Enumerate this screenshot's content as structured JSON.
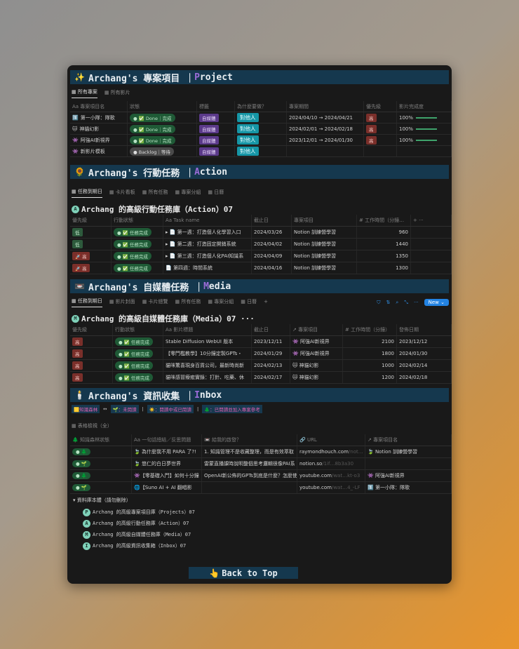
{
  "project": {
    "icon": "sparkles-icon",
    "title_pre": "Archang's 專案項目 ｜ ",
    "title_acc": "P",
    "title_post": "roject",
    "tabs": [
      "所有專案",
      "所有影片"
    ],
    "headers": [
      "Aa 專案項目名",
      "狀態",
      "標籤",
      "為什麼要做？",
      "專案期間",
      "優先級",
      "影片完成度"
    ],
    "rows": [
      {
        "icon": "1️⃣",
        "name": "第一小隊：隊歌",
        "status": "● ✅ Done｜完成",
        "tag": "自媒體",
        "why": "對他人",
        "period": "2024/04/10 → 2024/04/21",
        "priority": "高",
        "progress": "100%",
        "progress_value": 100
      },
      {
        "icon": "🐱",
        "name": "神貓幻影",
        "status": "● ✅ Done｜完成",
        "tag": "自媒體",
        "why": "對他人",
        "period": "2024/02/01 → 2024/02/18",
        "priority": "高",
        "progress": "100%",
        "progress_value": 100
      },
      {
        "icon": "👾",
        "name": "阿強AI新視界",
        "status": "● ✅ Done｜完成",
        "tag": "自媒體",
        "why": "對他人",
        "period": "2023/12/01 → 2024/01/30",
        "priority": "高",
        "progress": "100%",
        "progress_value": 100
      },
      {
        "icon": "👾",
        "name": "新影片模板",
        "status": "● Backlog｜等待",
        "tag": "自媒體",
        "why": "對他人",
        "period": "",
        "priority": "",
        "progress": "",
        "progress_value": 0
      }
    ]
  },
  "action": {
    "title_pre": "Archang's 行動任務 ｜ ",
    "title_acc": "A",
    "title_post": "ction",
    "tabs": [
      "任務到期日",
      "卡片看板",
      "所有任務",
      "專案分組",
      "日曆"
    ],
    "db_title": "Archang 的高級行動任務庫（Action）07",
    "headers": [
      "優先級",
      "行動狀態",
      "Aa Task name",
      "截止日",
      "專案項目",
      "# 工作時間（分鐘…",
      "+ ···"
    ],
    "rows": [
      {
        "priority": "低",
        "status": "● ✅ 任務完成",
        "task": "▸ 📄 第一週：打造個人化學習入口",
        "due": "2024/03/26",
        "project": "Notion 訓練營學習",
        "hours": "960"
      },
      {
        "priority": "低",
        "status": "● ✅ 任務完成",
        "task": "▸ 📄 第二週：打造固定開銷系統",
        "due": "2024/04/02",
        "project": "Notion 訓練營學習",
        "hours": "1440"
      },
      {
        "priority": "🚀 高",
        "status": "● ✅ 任務完成",
        "task": "▸ 📄 第三週：打造個人化PAI知識系",
        "due": "2024/04/09",
        "project": "Notion 訓練營學習",
        "hours": "1350"
      },
      {
        "priority": "🚀 高",
        "status": "● ✅ 任務完成",
        "task": "📄 第四週：時間系統",
        "due": "2024/04/16",
        "project": "Notion 訓練營學習",
        "hours": "1300"
      }
    ]
  },
  "media": {
    "title_pre": "Archang's 自媒體任務 ｜ ",
    "title_acc": "M",
    "title_post": "edia",
    "tabs": [
      "任務到期日",
      "影片封面",
      "卡片總覽",
      "所有任務",
      "專案分組",
      "日曆",
      "+"
    ],
    "new_label": "New ⌄",
    "db_title": "Archang 的高級自媒體任務庫（Media）07 ···",
    "headers": [
      "優先級",
      "行動狀態",
      "Aa 影片標題",
      "截止日",
      "↗ 專案項目",
      "# 工作時間（分鐘）",
      "發佈日期"
    ],
    "rows": [
      {
        "priority": "高",
        "status": "● ✅ 任務完成",
        "title": "Stable Diffusion WebUI 版本",
        "due": "2023/12/11",
        "project": "👾 阿強AI新視界",
        "hours": "2100",
        "release": "2023/12/12"
      },
      {
        "priority": "高",
        "status": "● ✅ 任務完成",
        "title": "【零門檻教學】10分鐘定製GPTs・",
        "due": "2024/01/29",
        "project": "👾 阿強AI新視界",
        "hours": "1800",
        "release": "2024/01/30"
      },
      {
        "priority": "高",
        "status": "● ✅ 任務完成",
        "title": "貓咪驚喜現身百貨公司，最新時尚新",
        "due": "2024/02/13",
        "project": "🐱 神貓幻影",
        "hours": "1000",
        "release": "2024/02/14"
      },
      {
        "priority": "高",
        "status": "● ✅ 任務完成",
        "title": "貓咪感冒療癒實錄：打針、吃藥、休",
        "due": "2024/02/17",
        "project": "🐱 神貓幻影",
        "hours": "1200",
        "release": "2024/02/18"
      }
    ]
  },
  "inbox": {
    "title_pre": "Archang's 資訊收集 ｜ ",
    "title_acc": "I",
    "title_post": "nbox",
    "legend": [
      "🟨知識森林",
      "↔",
      "🌱：未閱讀",
      "|",
      "☀️：閱讀中或已閱讀",
      "|",
      "🌲：已閱讀並加入專案參考"
    ],
    "view": "表格檢視（全）",
    "headers": [
      "🌲 知識森林狀態",
      "Aa 一句話總結／反思問題",
      "📼 給我的啟發？",
      "🔗 URL",
      "↗ 專案項目名"
    ],
    "rows": [
      {
        "state": "● 🌲",
        "summary": "🍃 為什麼我不用 PARA 了?!",
        "insight": "1. 知識管理不是收藏整理，而是有效萃取",
        "url": "raymondhouch.com",
        "url_tail": "/not…",
        "project": "🍃 Notion 訓練營學習"
      },
      {
        "state": "● 🌱",
        "summary": "🍃 悠仁的白日夢世界",
        "insight": "雷蒙直播課時說明整個思考邏輯很像PAI系",
        "url": "notion.so",
        "url_tail": "/1if…8b3a30",
        "project": ""
      },
      {
        "state": "● 🌲",
        "summary": "👾【零基礎入門】如何十分鐘",
        "insight": "OpenAI新公佈的GPTs到底是什麼？怎麼使",
        "url": "youtube.com",
        "url_tail": "/wat…kt-o3",
        "project": "👾 阿強AI新視界"
      },
      {
        "state": "● 🌱",
        "summary": "🌐【Suno AI + AI 翻唱影",
        "insight": "",
        "url": "youtube.com",
        "url_tail": "/wat…4_-LF",
        "project": "1️⃣ 第一小隊：隊歌"
      }
    ]
  },
  "databases": {
    "toggle": "▾ 資料庫本體（請勿刪除）",
    "items": [
      {
        "badge": "P",
        "label": "Archang 的高級專案項目庫（Projects）07"
      },
      {
        "badge": "A",
        "label": "Archang 的高級行動任務庫（Action）07"
      },
      {
        "badge": "M",
        "label": "Archang 的高級自媒體任務庫（Media）07"
      },
      {
        "badge": "I",
        "label": "Archang 的高級資訊收集箱（Inbox）07"
      }
    ]
  },
  "back_to_top": "Back to Top"
}
